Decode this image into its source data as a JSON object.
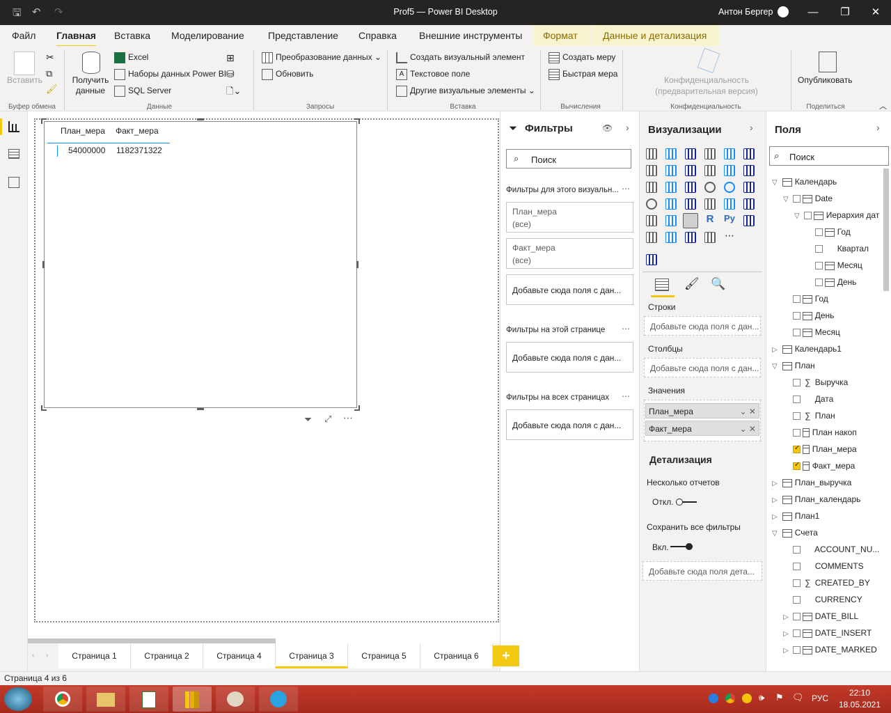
{
  "window": {
    "title": "Prof5 — Power BI Desktop",
    "user": "Антон Бергер"
  },
  "menu": [
    "Файл",
    "Главная",
    "Вставка",
    "Моделирование",
    "Представление",
    "Справка",
    "Внешние инструменты",
    "Формат",
    "Данные и детализация"
  ],
  "ribbon": {
    "paste": "Вставить",
    "clipboard_group": "Буфер обмена",
    "get_data": "Получить данные",
    "excel": "Excel",
    "datasets": "Наборы данных Power BI",
    "sql": "SQL Server",
    "data_group": "Данные",
    "transform": "Преобразование данных",
    "refresh": "Обновить",
    "queries_group": "Запросы",
    "new_visual": "Создать визуальный элемент",
    "text_box": "Текстовое поле",
    "more_visuals": "Другие визуальные элементы",
    "insert_group": "Вставка",
    "new_measure": "Создать меру",
    "quick_measure": "Быстрая мера",
    "calc_group": "Вычисления",
    "sensitivity": "Конфиденциальность (предварительная версия)",
    "sensitivity_group": "Конфиденциальность",
    "publish": "Опубликовать",
    "share_group": "Поделиться"
  },
  "table_visual": {
    "headers": [
      "План_мера",
      "Факт_мера"
    ],
    "values": [
      "54000000",
      "1182371322"
    ]
  },
  "filters": {
    "title": "Фильтры",
    "search_placeholder": "Поиск",
    "visual_header": "Фильтры для этого визуальн...",
    "cards": [
      {
        "name": "План_мера",
        "value": "(все)"
      },
      {
        "name": "Факт_мера",
        "value": "(все)"
      }
    ],
    "add_fields": "Добавьте сюда поля с дан...",
    "page_header": "Фильтры на этой странице",
    "all_header": "Фильтры на всех страницах"
  },
  "viz": {
    "title": "Визуализации",
    "rows": "Строки",
    "columns": "Столбцы",
    "values": "Значения",
    "add_fields": "Добавьте сюда поля с дан...",
    "value_chips": [
      "План_мера",
      "Факт_мера"
    ],
    "drill_title": "Детализация",
    "cross_report": "Несколько отчетов",
    "cross_state": "Откл.",
    "keep_filters": "Сохранить все фильтры",
    "keep_state": "Вкл.",
    "drill_add": "Добавьте сюда поля дета..."
  },
  "fields": {
    "title": "Поля",
    "search_placeholder": "Поиск",
    "items": [
      {
        "label": "Календарь",
        "level": 0,
        "arrow": "▽",
        "type": "table"
      },
      {
        "label": "Date",
        "level": 1,
        "arrow": "▽",
        "type": "date",
        "chk": false
      },
      {
        "label": "Иерархия дат",
        "level": 2,
        "arrow": "▽",
        "type": "hier",
        "chk": false
      },
      {
        "label": "Год",
        "level": 3,
        "arrow": "",
        "type": "hier",
        "chk": false
      },
      {
        "label": "Квартал",
        "level": 3,
        "arrow": "",
        "type": "none",
        "chk": false
      },
      {
        "label": "Месяц",
        "level": 3,
        "arrow": "",
        "type": "hier",
        "chk": false
      },
      {
        "label": "День",
        "level": 3,
        "arrow": "",
        "type": "hier",
        "chk": false
      },
      {
        "label": "Год",
        "level": 1,
        "arrow": "",
        "type": "hier",
        "chk": false
      },
      {
        "label": "День",
        "level": 1,
        "arrow": "",
        "type": "hier",
        "chk": false
      },
      {
        "label": "Месяц",
        "level": 1,
        "arrow": "",
        "type": "hier",
        "chk": false
      },
      {
        "label": "Календарь1",
        "level": 0,
        "arrow": "▷",
        "type": "table"
      },
      {
        "label": "План",
        "level": 0,
        "arrow": "▽",
        "type": "table"
      },
      {
        "label": "Выручка",
        "level": 1,
        "arrow": "",
        "type": "sum",
        "chk": false
      },
      {
        "label": "Дата",
        "level": 1,
        "arrow": "",
        "type": "none",
        "chk": false
      },
      {
        "label": "План",
        "level": 1,
        "arrow": "",
        "type": "sum",
        "chk": false
      },
      {
        "label": "План накоп",
        "level": 1,
        "arrow": "",
        "type": "calc",
        "chk": false
      },
      {
        "label": "План_мера",
        "level": 1,
        "arrow": "",
        "type": "calc",
        "chk": true
      },
      {
        "label": "Факт_мера",
        "level": 1,
        "arrow": "",
        "type": "calc",
        "chk": true
      },
      {
        "label": "План_выручка",
        "level": 0,
        "arrow": "▷",
        "type": "table"
      },
      {
        "label": "План_календарь",
        "level": 0,
        "arrow": "▷",
        "type": "table"
      },
      {
        "label": "План1",
        "level": 0,
        "arrow": "▷",
        "type": "table"
      },
      {
        "label": "Счета",
        "level": 0,
        "arrow": "▽",
        "type": "table"
      },
      {
        "label": "ACCOUNT_NU...",
        "level": 1,
        "arrow": "",
        "type": "none",
        "chk": false
      },
      {
        "label": "COMMENTS",
        "level": 1,
        "arrow": "",
        "type": "none",
        "chk": false
      },
      {
        "label": "CREATED_BY",
        "level": 1,
        "arrow": "",
        "type": "sum",
        "chk": false
      },
      {
        "label": "CURRENCY",
        "level": 1,
        "arrow": "",
        "type": "none",
        "chk": false
      },
      {
        "label": "DATE_BILL",
        "level": 1,
        "arrow": "▷",
        "type": "date",
        "chk": false
      },
      {
        "label": "DATE_INSERT",
        "level": 1,
        "arrow": "▷",
        "type": "date",
        "chk": false
      },
      {
        "label": "DATE_MARKED",
        "level": 1,
        "arrow": "▷",
        "type": "date",
        "chk": false
      }
    ]
  },
  "tabs": [
    "Страница 1",
    "Страница 2",
    "Страница 4",
    "Страница 3",
    "Страница 5",
    "Страница 6"
  ],
  "active_tab": 3,
  "status": "Страница 4 из 6",
  "tray": {
    "lang": "РУС",
    "time": "22:10",
    "date": "18.05.2021"
  },
  "colors": {
    "accent": "#f2c811",
    "taskbar": "#b33222",
    "titlebar": "#252423"
  }
}
